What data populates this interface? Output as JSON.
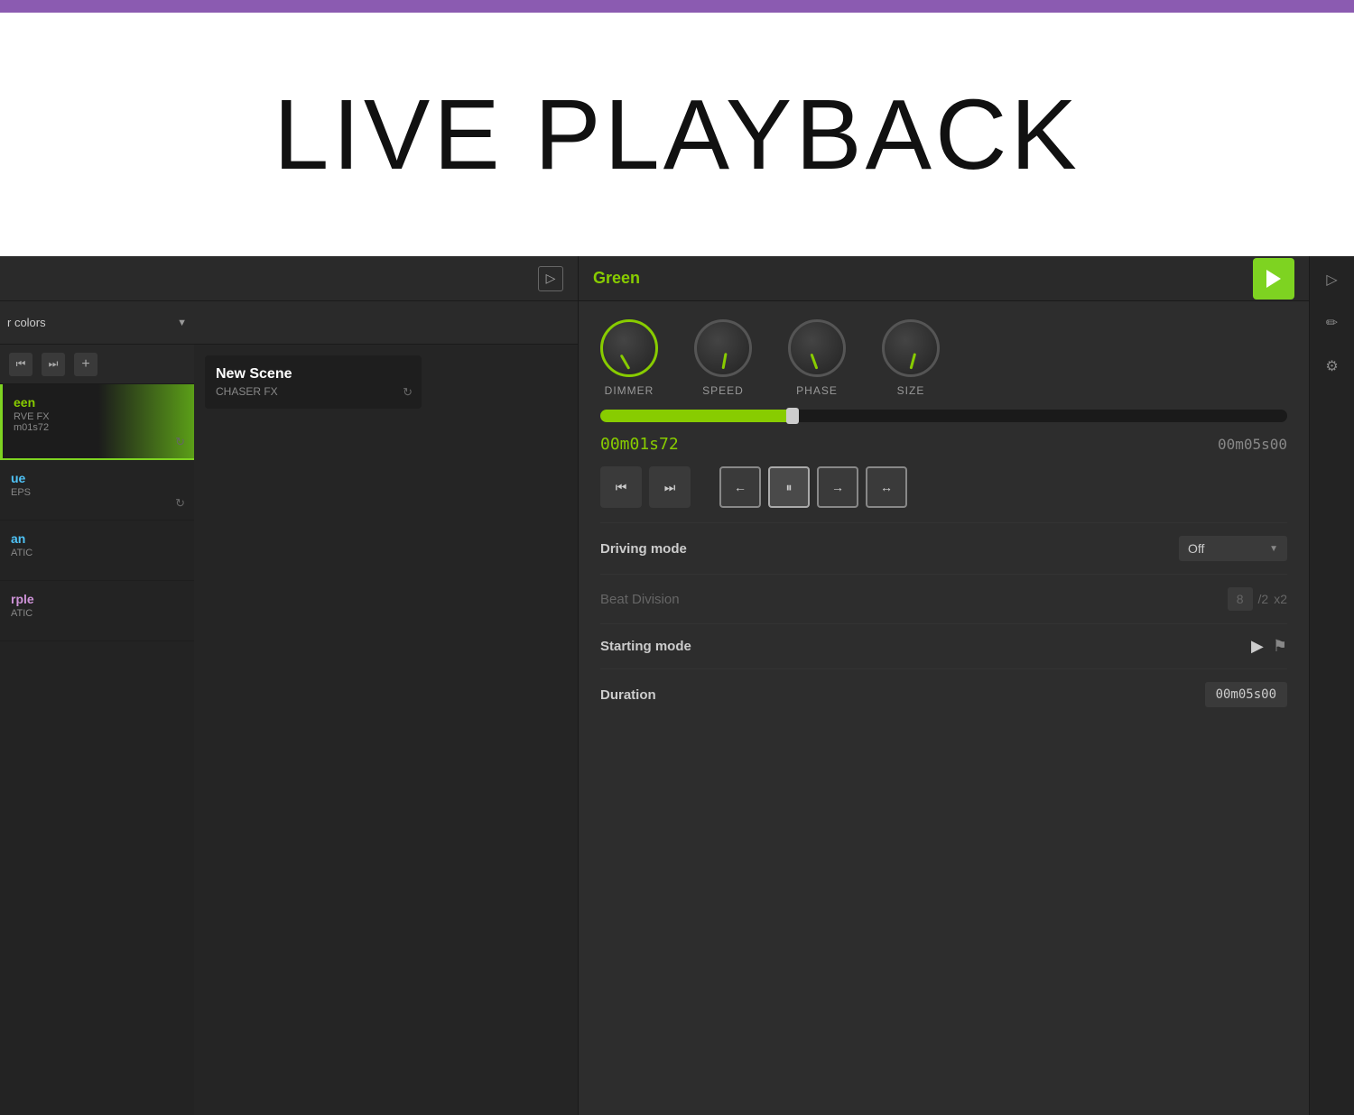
{
  "topbar": {
    "color": "#8b5bb1"
  },
  "title": {
    "text": "LIVE PLAYBACK"
  },
  "left_panel": {
    "playlist": {
      "name": "r colors",
      "items": [
        {
          "id": "green",
          "name": "een",
          "type": "RVE FX",
          "time": "m01s72",
          "active": true,
          "color": "green"
        },
        {
          "id": "blue",
          "name": "ue",
          "type": "EPS",
          "time": "",
          "active": false,
          "color": "blue"
        },
        {
          "id": "cyan",
          "name": "an",
          "type": "ATIC",
          "time": "",
          "active": false,
          "color": "cyan"
        },
        {
          "id": "purple",
          "name": "rple",
          "type": "ATIC",
          "time": "",
          "active": false,
          "color": "purple"
        }
      ],
      "controls": {
        "prev_label": "⏮",
        "next_label": "⏭",
        "add_label": "+"
      }
    },
    "scene_card": {
      "title": "New Scene",
      "subtitle": "CHASER FX"
    }
  },
  "right_panel": {
    "title": "Green",
    "play_button": "▶",
    "knobs": [
      {
        "id": "dimmer",
        "label": "DIMMER",
        "active": true
      },
      {
        "id": "speed",
        "label": "SPEED",
        "active": false
      },
      {
        "id": "phase",
        "label": "PHASE",
        "active": false
      },
      {
        "id": "size",
        "label": "SIZE",
        "active": false
      }
    ],
    "progress": {
      "fill_percent": 28,
      "current_time": "00m01s72",
      "total_time": "00m05s00"
    },
    "transport": {
      "buttons": [
        {
          "id": "skip-back",
          "icon": "⏮",
          "active": false
        },
        {
          "id": "skip-forward",
          "icon": "⏭",
          "active": false
        },
        {
          "id": "arrow-left",
          "icon": "←",
          "active": false,
          "highlighted": true
        },
        {
          "id": "pause",
          "icon": "⏸",
          "active": true,
          "highlighted": true
        },
        {
          "id": "arrow-right",
          "icon": "→",
          "active": false,
          "highlighted": true
        },
        {
          "id": "bounce",
          "icon": "↔",
          "active": false,
          "highlighted": true
        }
      ]
    },
    "settings": [
      {
        "id": "driving-mode",
        "label": "Driving mode",
        "control_type": "dropdown",
        "value": "Off"
      },
      {
        "id": "beat-division",
        "label": "Beat Division",
        "control_type": "beat",
        "value": "8",
        "div": "/2",
        "mul": "x2",
        "muted": true
      },
      {
        "id": "starting-mode",
        "label": "Starting mode",
        "control_type": "mode-icons"
      },
      {
        "id": "duration",
        "label": "Duration",
        "control_type": "value",
        "value": "00m05s00"
      }
    ]
  },
  "side_icons": [
    {
      "id": "panel-icon",
      "symbol": "▷",
      "name": "panel-icon"
    },
    {
      "id": "edit-icon",
      "symbol": "✏",
      "name": "edit-icon"
    },
    {
      "id": "settings-icon",
      "symbol": "⚙",
      "name": "settings-icon"
    }
  ]
}
